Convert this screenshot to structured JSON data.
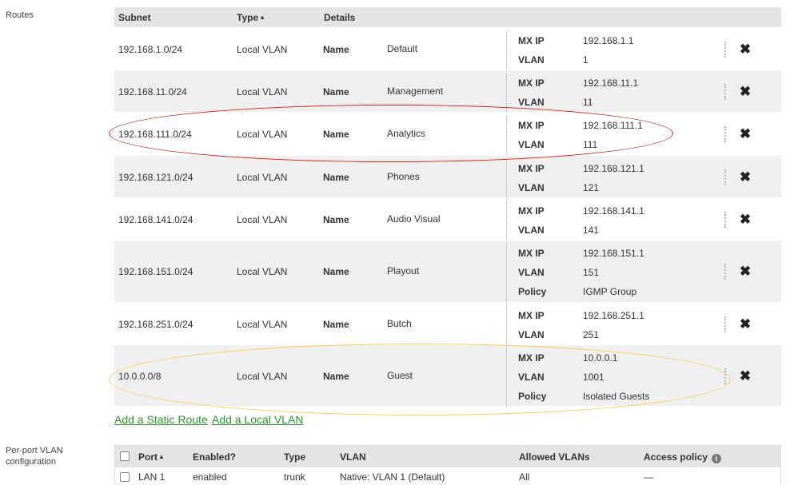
{
  "sections": {
    "routes_label": "Routes",
    "perport_label_line1": "Per-port VLAN",
    "perport_label_line2": "configuration"
  },
  "routes": {
    "headers": {
      "subnet": "Subnet",
      "type": "Type",
      "type_sort_icon": "▲",
      "details": "Details"
    },
    "rows": [
      {
        "subnet": "192.168.1.0/24",
        "type": "Local VLAN",
        "name_label": "Name",
        "name": "Default",
        "kv": [
          {
            "k": "MX IP",
            "v": "192.168.1.1"
          },
          {
            "k": "VLAN",
            "v": "1"
          }
        ]
      },
      {
        "subnet": "192.168.11.0/24",
        "type": "Local VLAN",
        "name_label": "Name",
        "name": "Management",
        "kv": [
          {
            "k": "MX IP",
            "v": "192.168.11.1"
          },
          {
            "k": "VLAN",
            "v": "11"
          }
        ]
      },
      {
        "subnet": "192.168.111.0/24",
        "type": "Local VLAN",
        "name_label": "Name",
        "name": "Analytics",
        "kv": [
          {
            "k": "MX IP",
            "v": "192.168.111.1"
          },
          {
            "k": "VLAN",
            "v": "111"
          }
        ]
      },
      {
        "subnet": "192.168.121.0/24",
        "type": "Local VLAN",
        "name_label": "Name",
        "name": "Phones",
        "kv": [
          {
            "k": "MX IP",
            "v": "192.168.121.1"
          },
          {
            "k": "VLAN",
            "v": "121"
          }
        ]
      },
      {
        "subnet": "192.168.141.0/24",
        "type": "Local VLAN",
        "name_label": "Name",
        "name": "Audio Visual",
        "kv": [
          {
            "k": "MX IP",
            "v": "192.168.141.1"
          },
          {
            "k": "VLAN",
            "v": "141"
          }
        ]
      },
      {
        "subnet": "192.168.151.0/24",
        "type": "Local VLAN",
        "name_label": "Name",
        "name": "Playout",
        "kv": [
          {
            "k": "MX IP",
            "v": "192.168.151.1"
          },
          {
            "k": "VLAN",
            "v": "151"
          },
          {
            "k": "Policy",
            "v": "IGMP Group"
          }
        ]
      },
      {
        "subnet": "192.168.251.0/24",
        "type": "Local VLAN",
        "name_label": "Name",
        "name": "Butch",
        "kv": [
          {
            "k": "MX IP",
            "v": "192.168.251.1"
          },
          {
            "k": "VLAN",
            "v": "251"
          }
        ]
      },
      {
        "subnet": "10.0.0.0/8",
        "type": "Local VLAN",
        "name_label": "Name",
        "name": "Guest",
        "kv": [
          {
            "k": "MX IP",
            "v": "10.0.0.1"
          },
          {
            "k": "VLAN",
            "v": "1001"
          },
          {
            "k": "Policy",
            "v": "Isolated Guests"
          }
        ]
      }
    ],
    "delete_icon": "✖"
  },
  "links": {
    "add_static_route": "Add a Static Route",
    "add_local_vlan": "Add a Local VLAN"
  },
  "annotations": {
    "red_color": "#d62020",
    "yellow_color": "#f0cf5a"
  },
  "ports": {
    "headers": {
      "port": "Port",
      "port_sort_icon": "▲",
      "enabled": "Enabled?",
      "type": "Type",
      "vlan": "VLAN",
      "allowed": "Allowed VLANs",
      "access": "Access policy",
      "info_icon": "i"
    },
    "rows": [
      {
        "port": "LAN 1",
        "enabled": "enabled",
        "type": "trunk",
        "vlan": "Native: VLAN 1 (Default)",
        "allowed": "All",
        "access": "—"
      }
    ]
  }
}
